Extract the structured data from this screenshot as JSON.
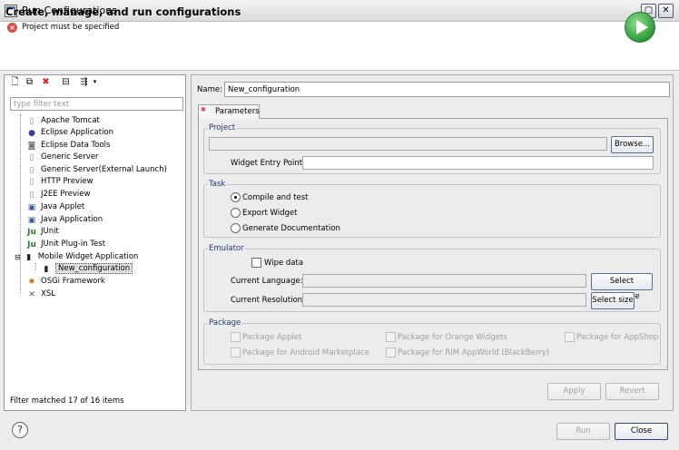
{
  "window": {
    "title": "Run Configurations"
  },
  "header": {
    "title": "Create, manage, and run configurations",
    "message": "Project must be specified"
  },
  "sidebar": {
    "filter_placeholder": "type filter text",
    "items": [
      {
        "label": "Apache Tomcat",
        "icon": "tomcat-icon"
      },
      {
        "label": "Eclipse Application",
        "icon": "eclipse-icon"
      },
      {
        "label": "Eclipse Data Tools",
        "icon": "database-icon"
      },
      {
        "label": "Generic Server",
        "icon": "server-icon"
      },
      {
        "label": "Generic Server(External Launch)",
        "icon": "server-icon"
      },
      {
        "label": "HTTP Preview",
        "icon": "server-icon"
      },
      {
        "label": "J2EE Preview",
        "icon": "server-icon"
      },
      {
        "label": "Java Applet",
        "icon": "applet-icon"
      },
      {
        "label": "Java Application",
        "icon": "java-app-icon"
      },
      {
        "label": "JUnit",
        "icon": "junit-icon"
      },
      {
        "label": "JUnit Plug-in Test",
        "icon": "junit-plugin-icon"
      },
      {
        "label": "Mobile Widget Application",
        "icon": "mobile-widget-icon"
      },
      {
        "label": "New_configuration",
        "icon": "mobile-widget-icon",
        "selected": true
      },
      {
        "label": "OSGi Framework",
        "icon": "osgi-icon"
      },
      {
        "label": "XSL",
        "icon": "xsl-icon"
      }
    ],
    "status": "Filter matched 17 of 16 items"
  },
  "form": {
    "name_label": "Name:",
    "name_value": "New_configuration",
    "tab_label": "Parameters",
    "project": {
      "title": "Project",
      "browse_label": "Browse...",
      "entry_point_label": "Widget Entry Point:",
      "entry_point_value": ""
    },
    "task": {
      "title": "Task",
      "options": [
        "Compile and test",
        "Export Widget",
        "Generate Documentation"
      ],
      "selected": "Compile and test"
    },
    "emulator": {
      "title": "Emulator",
      "wipe_label": "Wipe data",
      "language_label": "Current Language:",
      "language_button": "Select language",
      "resolution_label": "Current Resolution:",
      "resolution_button": "Select size"
    },
    "package": {
      "title": "Package",
      "options": [
        "Package Applet",
        "Package for Orange Widgets",
        "Package for AppShop",
        "Package for Android Marketplace",
        "Package for RIM AppWorld (BlackBerry)"
      ]
    },
    "apply_label": "Apply",
    "revert_label": "Revert"
  },
  "footer": {
    "run_label": "Run",
    "close_label": "Close"
  },
  "colors": {
    "accent": "#1f3a7a",
    "error": "#e04848",
    "run_green": "#2f9a3a"
  }
}
